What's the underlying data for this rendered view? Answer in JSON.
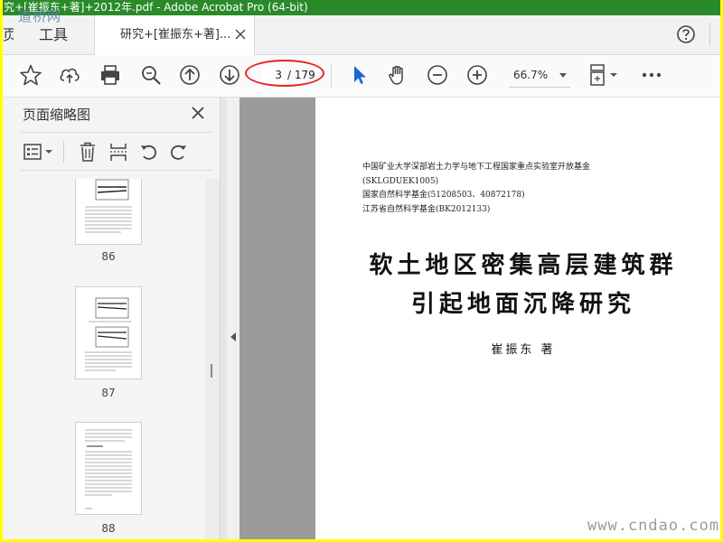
{
  "window": {
    "title": "究+[崔振东+著]+2012年.pdf - Adobe Acrobat Pro (64-bit)",
    "watermark_top": "道桥网",
    "watermark_bottom": "www.cndao.com"
  },
  "tabs": {
    "home_label": "页",
    "tools_label": "工具",
    "doc_label": "研究+[崔振东+著]..."
  },
  "toolbar": {
    "page_current": "3",
    "page_total": "/ 179",
    "zoom": "66.7%"
  },
  "icons": {
    "toolbar": [
      "star-icon",
      "cloud-upload-icon",
      "print-icon",
      "zoom-search-icon",
      "arrow-up-icon",
      "arrow-down-icon",
      "cursor-icon",
      "hand-icon",
      "zoom-out-icon",
      "zoom-in-icon",
      "page-display-icon",
      "more-icon"
    ],
    "panel": [
      "options-icon",
      "trash-icon",
      "extract-icon",
      "undo-icon",
      "redo-icon"
    ]
  },
  "panel": {
    "title": "页面缩略图",
    "thumbnails": [
      {
        "label": "86"
      },
      {
        "label": "87"
      },
      {
        "label": "88"
      }
    ]
  },
  "document": {
    "funding": [
      "中国矿业大学深部岩土力学与地下工程国家重点实验室开放基金",
      "(SKLGDUEK1005)",
      "国家自然科学基金(51208503、40872178)",
      "江苏省自然科学基金(BK2012133)"
    ],
    "title_line1": "软土地区密集高层建筑群",
    "title_line2": "引起地面沉降研究",
    "author": "崔振东 著"
  },
  "colors": {
    "screenshot_border": "#ffff00",
    "titlebar": "#2a8a2a",
    "annotation_oval": "#e52525",
    "cursor_blue": "#1a66d6"
  }
}
